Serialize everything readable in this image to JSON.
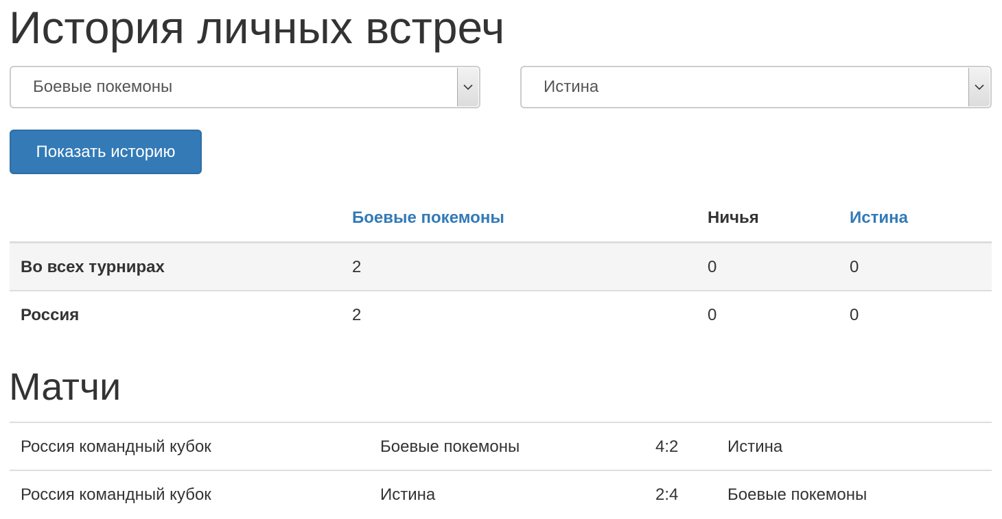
{
  "page": {
    "title": "История личных встреч"
  },
  "filters": {
    "team_left": "Боевые покемоны",
    "team_right": "Истина",
    "arrow_icon": "chevron-down-icon"
  },
  "actions": {
    "show_history_label": "Показать историю"
  },
  "stats": {
    "headers": {
      "empty": "",
      "team_left": "Боевые покемоны",
      "draw": "Ничья",
      "team_right": "Истина"
    },
    "rows": [
      {
        "label": "Во всех турнирах",
        "left_wins": "2",
        "draws": "0",
        "right_wins": "0"
      },
      {
        "label": "Россия",
        "left_wins": "2",
        "draws": "0",
        "right_wins": "0"
      }
    ]
  },
  "matches": {
    "title": "Матчи",
    "rows": [
      {
        "tournament": "Россия командный кубок",
        "home": "Боевые покемоны",
        "score": "4:2",
        "away": "Истина"
      },
      {
        "tournament": "Россия командный кубок",
        "home": "Истина",
        "score": "2:4",
        "away": "Боевые покемоны"
      }
    ]
  },
  "colors": {
    "primary": "#337ab7",
    "link": "#337ab7",
    "text": "#333333",
    "border": "#dddddd",
    "stripe": "#f5f5f5"
  }
}
